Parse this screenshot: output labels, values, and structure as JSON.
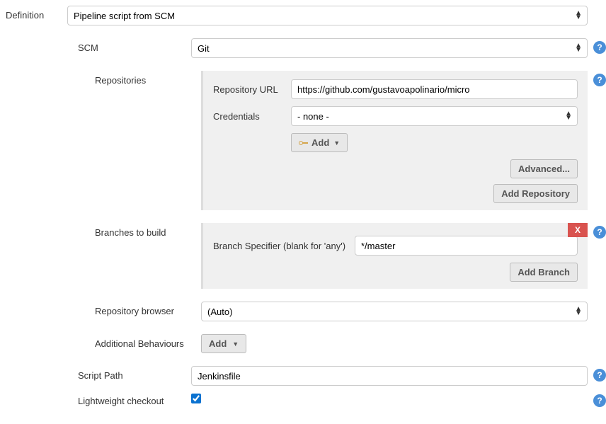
{
  "definition": {
    "label": "Definition",
    "value": "Pipeline script from SCM"
  },
  "scm": {
    "label": "SCM",
    "value": "Git"
  },
  "repositories": {
    "label": "Repositories",
    "url_label": "Repository URL",
    "url_value": "https://github.com/gustavoapolinario/micro",
    "credentials_label": "Credentials",
    "credentials_value": "- none -",
    "add_btn": "Add",
    "advanced_btn": "Advanced...",
    "add_repo_btn": "Add Repository"
  },
  "branches": {
    "label": "Branches to build",
    "specifier_label": "Branch Specifier (blank for 'any')",
    "specifier_value": "*/master",
    "add_branch_btn": "Add Branch",
    "close_x": "X"
  },
  "repo_browser": {
    "label": "Repository browser",
    "value": "(Auto)"
  },
  "additional": {
    "label": "Additional Behaviours",
    "add_btn": "Add"
  },
  "script_path": {
    "label": "Script Path",
    "value": "Jenkinsfile"
  },
  "lightweight": {
    "label": "Lightweight checkout"
  }
}
